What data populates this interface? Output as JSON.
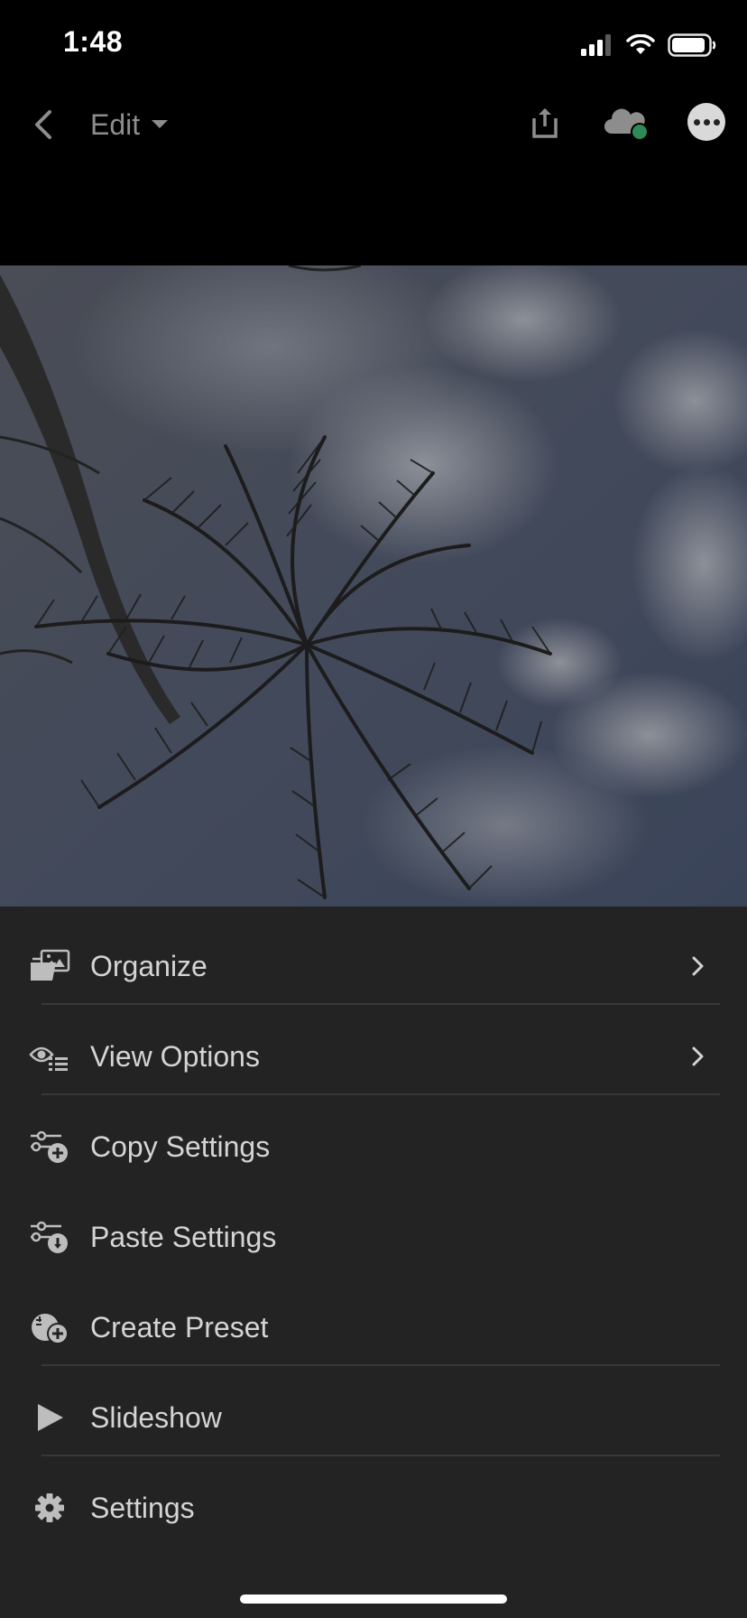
{
  "status": {
    "time": "1:48",
    "icons": [
      "signal-icon",
      "wifi-icon",
      "battery-icon"
    ]
  },
  "nav": {
    "mode_label": "Edit",
    "icons": [
      "back-chevron-icon",
      "dropdown-caret-icon",
      "share-icon",
      "cloud-sync-icon",
      "more-icon"
    ],
    "sync_status_color": "#2e8b57"
  },
  "photo": {
    "subject": "palm-trees-and-cloudy-sky"
  },
  "menu": {
    "items": [
      {
        "label": "Organize",
        "icon": "folder-image-icon",
        "has_submenu": true
      },
      {
        "label": "View Options",
        "icon": "eye-list-icon",
        "has_submenu": true
      },
      {
        "label": "Copy Settings",
        "icon": "sliders-plus-icon",
        "has_submenu": false
      },
      {
        "label": "Paste Settings",
        "icon": "sliders-paste-icon",
        "has_submenu": false
      },
      {
        "label": "Create Preset",
        "icon": "preset-plus-icon",
        "has_submenu": false
      },
      {
        "label": "Slideshow",
        "icon": "play-icon",
        "has_submenu": false
      },
      {
        "label": "Settings",
        "icon": "gear-icon",
        "has_submenu": false
      }
    ]
  },
  "colors": {
    "menu_bg": "#232323",
    "background": "#000000",
    "text": "#d4d4d4"
  }
}
